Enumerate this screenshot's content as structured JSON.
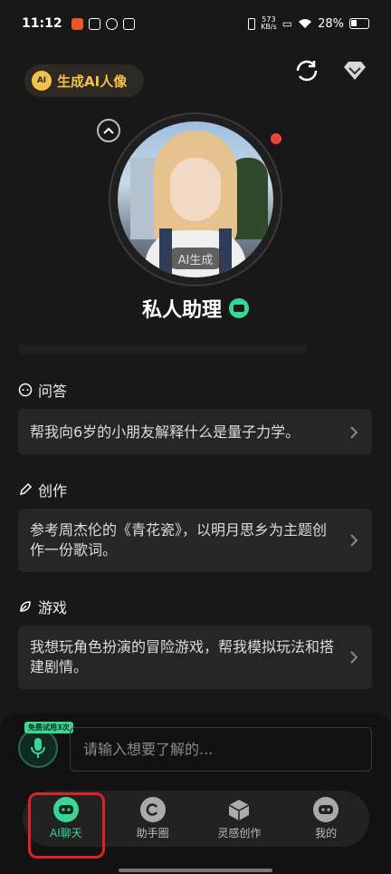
{
  "status_bar": {
    "time": "11:12",
    "net_speed_value": "573",
    "net_speed_unit": "KB/s",
    "battery": "28%"
  },
  "header": {
    "generate_button_label": "生成AI人像",
    "ai_badge": "AI"
  },
  "assistant": {
    "ai_generated_tag": "AI生成",
    "name": "私人助理"
  },
  "sections": [
    {
      "title": "问答",
      "icon": "chat-bubble-icon",
      "card_text": "帮我向6岁的小朋友解释什么是量子力学。"
    },
    {
      "title": "创作",
      "icon": "pen-icon",
      "card_text": "参考周杰伦的《青花瓷》，以明月思乡为主题创作一份歌词。"
    },
    {
      "title": "游戏",
      "icon": "leaf-icon",
      "card_text": "我想玩角色扮演的冒险游戏，帮我模拟玩法和搭建剧情。"
    }
  ],
  "input": {
    "trial_badge": "免费试用3次",
    "placeholder": "请输入想要了解的..."
  },
  "tabs": [
    {
      "label": "AI聊天",
      "icon": "robot-icon",
      "active": true
    },
    {
      "label": "助手圈",
      "icon": "circle-c-icon",
      "active": false
    },
    {
      "label": "灵感创作",
      "icon": "cube-icon",
      "active": false
    },
    {
      "label": "我的",
      "icon": "profile-bot-icon",
      "active": false
    }
  ],
  "colors": {
    "background": "#181818",
    "accent_green": "#3ad694",
    "accent_gold": "#f4c14a",
    "highlight_red": "#e0202a"
  }
}
